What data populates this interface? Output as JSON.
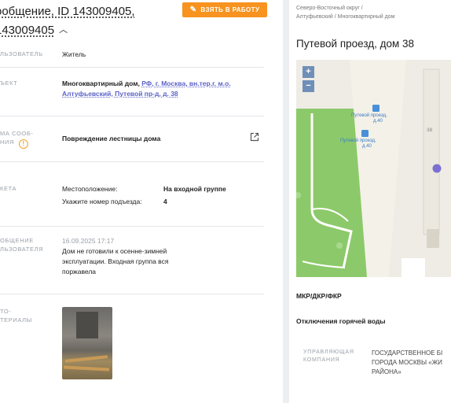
{
  "request": {
    "title_line1": "ообщение, ID 143009405,",
    "title_line2": "143009405",
    "take_button": "ВЗЯТЬ В РАБОТУ"
  },
  "fields": {
    "user_label": "ЛЬЗОВАТЕЛЬ",
    "user_value": "Житель",
    "object_label": "ЪЕКТ",
    "object_prefix": "Многоквартирный дом,",
    "object_link_1": "РФ, г. Москва, вн.тер.г. м.о.",
    "object_link_2": "Алтуфьевский, Путевой пр-д, д. 38",
    "topic_label_1": "МА СООБ-",
    "topic_label_2": "НИЯ",
    "topic_value": "Повреждение лестницы дома",
    "loc_label": "КЕТА",
    "loc_q1": "Местоположение:",
    "loc_a1": "На входной группе",
    "loc_q2": "Укажите номер подъезда:",
    "loc_a2": "4",
    "msg_label_1": "ОБЩЕНИЕ",
    "msg_label_2": "ЛЬЗОВАТЕЛЯ",
    "msg_date": "16.09.2025 17:17",
    "msg_line1": "Дом не готовили к осенне-зимней",
    "msg_line2": "эксплуатации. Входная группа вся",
    "msg_line3": "поржавела",
    "photo_label_1": "ТО-",
    "photo_label_2": "ТЕРИАЛЫ"
  },
  "right": {
    "crumb_line1": "Северо-Восточный округ /",
    "crumb_line2": "Алтуфьевский / Многоквартирный дом",
    "address": "Путевой проезд, дом 38",
    "map_zoom_in": "+",
    "map_zoom_out": "−",
    "map_label_1a": "Путевой проезд,",
    "map_label_1b": "д.40",
    "map_label_2a": "Путевой проезд,",
    "map_label_2b": "д.40",
    "map_house_number": "38",
    "section_1": "МКР/ДКР/ФКР",
    "section_2": "Отключения горячей воды",
    "uk_label_1": "УПРАВЛЯЮЩАЯ",
    "uk_label_2": "КОМПАНИЯ",
    "uk_value_1": "ГОСУДАРСТВЕННОЕ БІ",
    "uk_value_2": "ГОРОДА МОСКВЫ «ЖИ",
    "uk_value_3": "РАЙОНА»"
  },
  "colors": {
    "accent_orange": "#f7931e",
    "link_purple": "#5b63c7",
    "warning": "#f2a32a",
    "map_green": "#8cc96a"
  }
}
